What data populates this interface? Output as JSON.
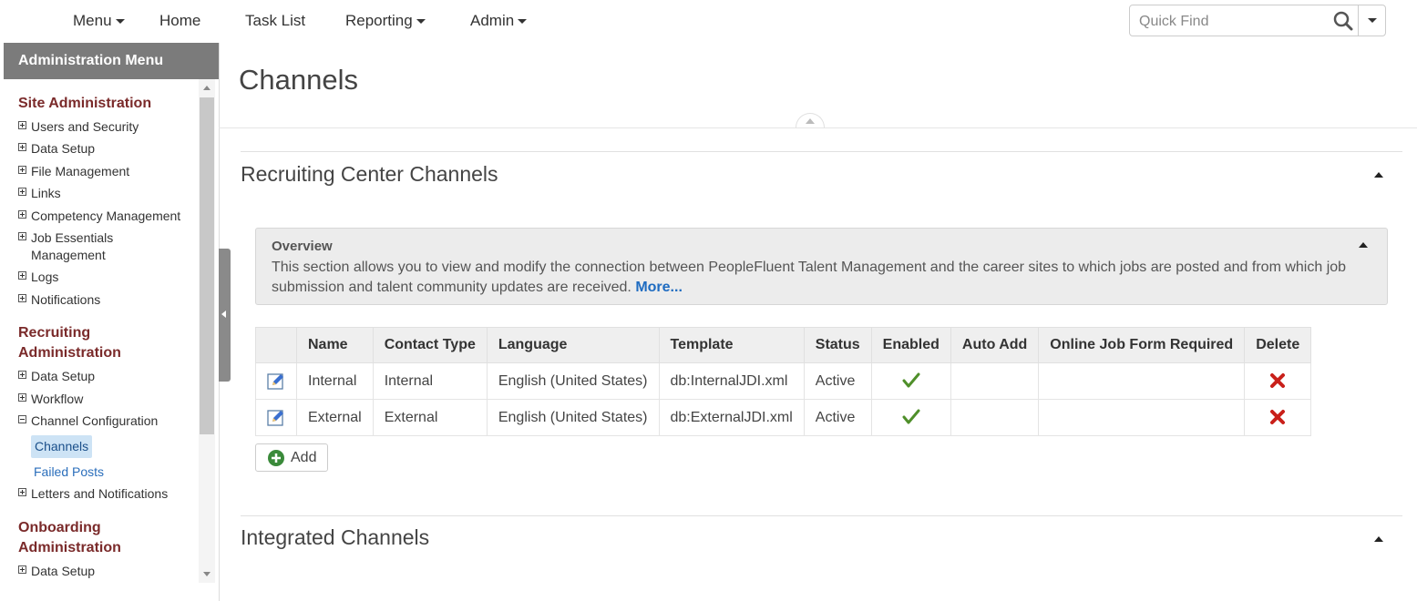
{
  "topnav": {
    "menu": "Menu",
    "home": "Home",
    "task_list": "Task List",
    "reporting": "Reporting",
    "admin": "Admin",
    "quickfind_placeholder": "Quick Find"
  },
  "sidebar": {
    "header": "Administration Menu",
    "site_admin": {
      "title": "Site Administration",
      "items": [
        "Users and Security",
        "Data Setup",
        "File Management",
        "Links",
        "Competency Management",
        "Job Essentials Management",
        "Logs",
        "Notifications"
      ]
    },
    "recruiting_admin": {
      "title": "Recruiting Administration",
      "items": [
        "Data Setup",
        "Workflow",
        "Channel Configuration"
      ],
      "sub_items": [
        "Channels",
        "Failed Posts"
      ],
      "after": "Letters and Notifications"
    },
    "onboarding_admin": {
      "title": "Onboarding Administration",
      "items": [
        "Data Setup"
      ]
    }
  },
  "page": {
    "title": "Channels"
  },
  "recruiting_center": {
    "title": "Recruiting Center Channels",
    "overview_title": "Overview",
    "overview_text": "This section allows you to view and modify the connection between PeopleFluent Talent Management and the career sites to which jobs are posted and from which job submission and talent community updates are received.",
    "overview_more": "More...",
    "columns": [
      "Name",
      "Contact Type",
      "Language",
      "Template",
      "Status",
      "Enabled",
      "Auto Add",
      "Online Job Form Required",
      "Delete"
    ],
    "rows": [
      {
        "name": "Internal",
        "contact_type": "Internal",
        "language": "English (United States)",
        "template": "db:InternalJDI.xml",
        "status": "Active",
        "enabled": true,
        "auto_add": "",
        "online_job_form_required": ""
      },
      {
        "name": "External",
        "contact_type": "External",
        "language": "English (United States)",
        "template": "db:ExternalJDI.xml",
        "status": "Active",
        "enabled": true,
        "auto_add": "",
        "online_job_form_required": ""
      }
    ],
    "add_label": "Add"
  },
  "integrated": {
    "title": "Integrated Channels"
  },
  "colors": {
    "section_heading": "#7a2a2a",
    "sidebar_header_bg": "#7b7b7b",
    "link": "#1f6cc1",
    "check": "#4f8f2a",
    "delete": "#c9201a",
    "add_icon": "#3a8a3a"
  }
}
